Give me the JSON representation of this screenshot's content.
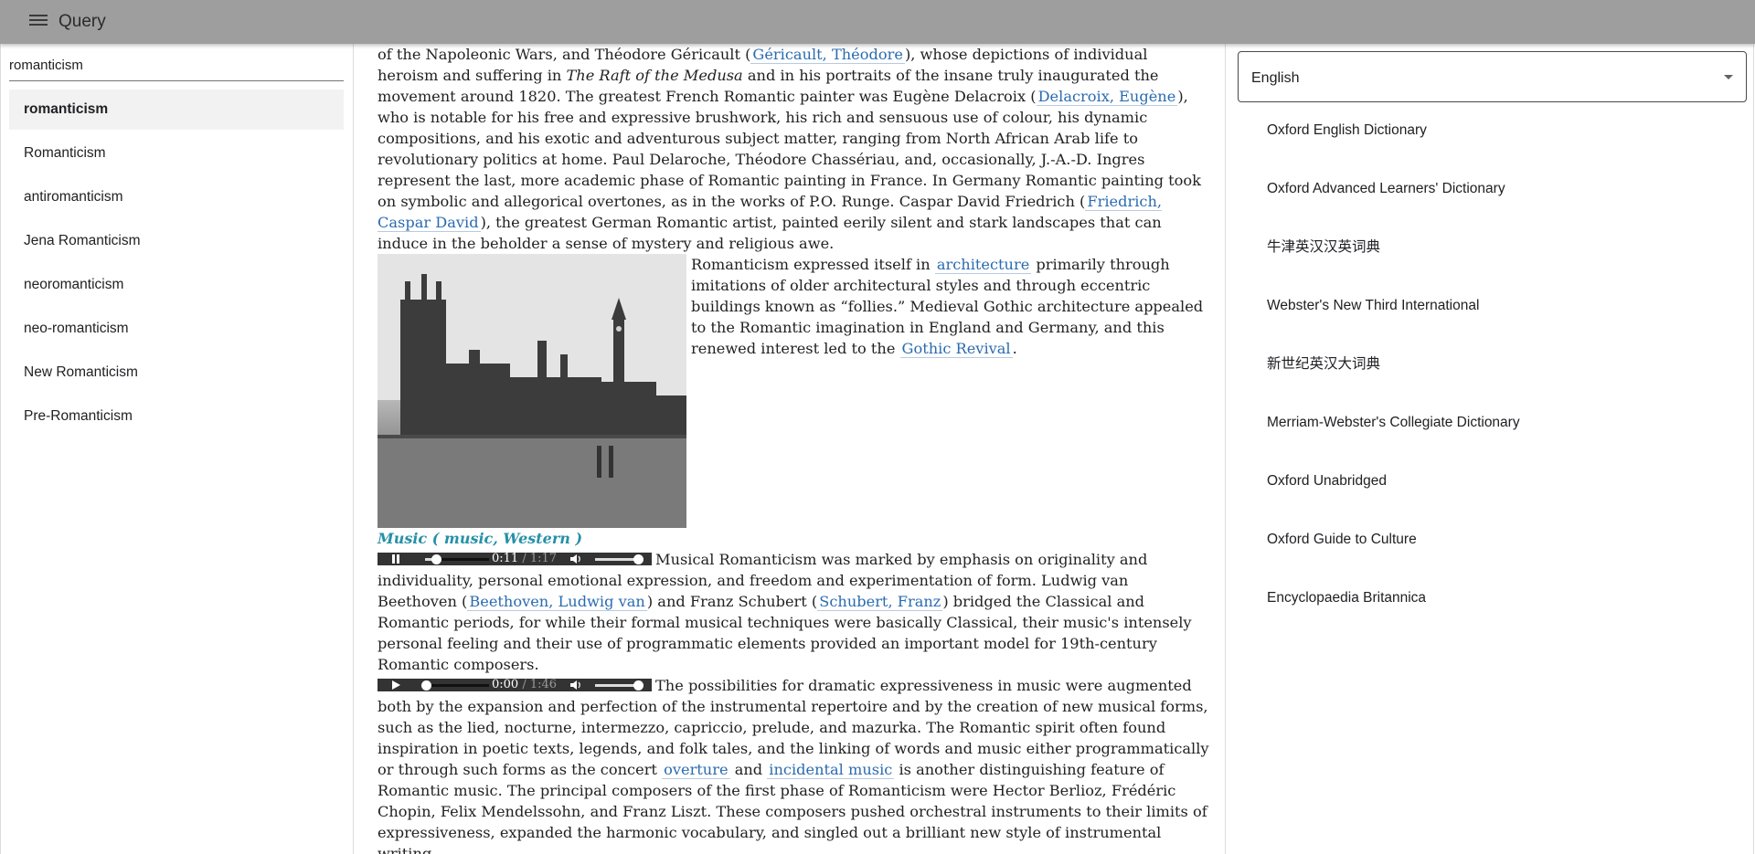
{
  "header": {
    "title": "Query"
  },
  "search": {
    "value": "romanticism"
  },
  "results": [
    {
      "label": "romanticism",
      "selected": true
    },
    {
      "label": "Romanticism"
    },
    {
      "label": "antiromanticism"
    },
    {
      "label": "Jena Romanticism"
    },
    {
      "label": "neoromanticism"
    },
    {
      "label": "neo-romanticism"
    },
    {
      "label": "New Romanticism"
    },
    {
      "label": "Pre-Romanticism"
    }
  ],
  "article": {
    "p1": {
      "t1": "of the Napoleonic Wars, and Théodore Géricault (",
      "l1": "Géricault, Théodore",
      "t2": "), whose depictions of individual heroism and suffering in ",
      "i1": "The Raft of the Medusa",
      "t3": " and in his portraits of the insane truly inaugurated the movement around 1820. The greatest French Romantic painter was Eugène Delacroix (",
      "l2": "Delacroix, Eugène",
      "t4": "), who is notable for his free and expressive brushwork, his rich and sensuous use of colour, his dynamic compositions, and his exotic and adventurous subject matter, ranging from North African Arab life to revolutionary politics at home. Paul Delaroche, Théodore Chassériau, and, occasionally, J.-A.-D. Ingres represent the last, more academic phase of Romantic painting in France. In Germany Romantic painting took on symbolic and allegorical overtones, as in the works of P.O. Runge. Caspar David Friedrich (",
      "l3": "Friedrich, Caspar David",
      "t5": "), the greatest German Romantic artist, painted eerily silent and stark landscapes that can induce in the beholder a sense of mystery and religious awe."
    },
    "p2": {
      "t1": " Romanticism expressed itself in ",
      "l1": "architecture",
      "t2": " primarily through imitations of older architectural styles and through eccentric buildings known as “follies.” Medieval Gothic architecture appealed to the Romantic imagination in England and Germany, and this renewed interest led to the ",
      "l2": "Gothic Revival",
      "t3": "."
    },
    "section": "Music ( music, Western )",
    "audio1": {
      "current": "0:11",
      "duration": " / 1:17",
      "progress": 0.15
    },
    "p3": {
      "t1": "Musical Romanticism was marked by emphasis on originality and individuality, personal emotional expression, and freedom and experimentation of form. Ludwig van Beethoven (",
      "l1": "Beethoven, Ludwig van",
      "t2": ") and Franz Schubert (",
      "l2": "Schubert, Franz",
      "t3": ") bridged the Classical and Romantic periods, for while their formal musical techniques were basically Classical, their music's intensely personal feeling and their use of programmatic elements provided an important model for 19th-century Romantic composers."
    },
    "audio2": {
      "current": "0:00",
      "duration": " / 1:46",
      "progress": 0.0
    },
    "p4": {
      "t1": "The possibilities for dramatic expressiveness in music were augmented both by the expansion and perfection of the instrumental repertoire and by the creation of new musical forms, such as the lied, nocturne, intermezzo, capriccio, prelude, and mazurka. The Romantic spirit often found inspiration in poetic texts, legends, and folk tales, and the linking of words and music either programmatically or through such forms as the concert ",
      "l1": "overture",
      "t2": " and ",
      "l2": "incidental music",
      "t3": " is another distinguishing feature of Romantic music. The principal composers of the first phase of Romanticism were Hector Berlioz, Frédéric Chopin, Felix Mendelssohn, and Franz Liszt. These composers pushed orchestral instruments to their limits of expressiveness, expanded the harmonic vocabulary, and singled out a brilliant new style of instrumental writing."
    }
  },
  "language": {
    "selected": "English"
  },
  "dictionaries": [
    "Oxford English Dictionary",
    "Oxford Advanced Learners' Dictionary",
    "牛津英汉汉英词典",
    "Webster's New Third International",
    "新世纪英汉大词典",
    "Merriam-Webster's Collegiate Dictionary",
    "Oxford Unabridged",
    "Oxford Guide to Culture",
    "Encyclopaedia Britannica"
  ],
  "colors": {
    "topbar": "#9e9e9e",
    "link": "#2a6bb0",
    "section": "#2590a8",
    "selected_bg": "#f2f2f2"
  }
}
